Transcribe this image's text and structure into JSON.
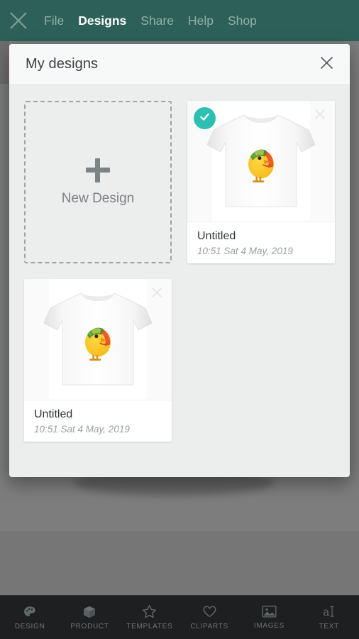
{
  "topbar": {
    "close_icon": "close-icon",
    "background": "#2d6157",
    "items": [
      {
        "label": "File",
        "active": false
      },
      {
        "label": "Designs",
        "active": true
      },
      {
        "label": "Share",
        "active": false
      },
      {
        "label": "Help",
        "active": false
      },
      {
        "label": "Shop",
        "active": false
      }
    ]
  },
  "modal": {
    "title": "My designs",
    "close_icon": "close-icon",
    "new_design": {
      "label": "New Design",
      "icon": "plus-icon"
    },
    "designs": [
      {
        "title": "Untitled",
        "date": "10:51 Sat 4 May, 2019",
        "selected": true,
        "check_icon": "check-icon",
        "remove_icon": "close-icon",
        "thumbnail": "tshirt-bird-thumbnail"
      },
      {
        "title": "Untitled",
        "date": "10:51 Sat 4 May, 2019",
        "selected": false,
        "check_icon": "check-icon",
        "remove_icon": "close-icon",
        "thumbnail": "tshirt-bird-thumbnail"
      }
    ]
  },
  "bottombar": {
    "background": "#1d1f21",
    "items": [
      {
        "label": "DESIGN",
        "icon": "palette-icon"
      },
      {
        "label": "PRODUCT",
        "icon": "box-icon"
      },
      {
        "label": "TEMPLATES",
        "icon": "star-icon"
      },
      {
        "label": "CLIPARTS",
        "icon": "heart-icon"
      },
      {
        "label": "IMAGES",
        "icon": "image-icon"
      },
      {
        "label": "TEXT",
        "icon": "text-cursor-icon"
      }
    ]
  },
  "colors": {
    "accent_teal": "#2cc0b3",
    "topbar_green": "#2d6157",
    "modal_bg": "#eceded",
    "toolbar_dark": "#1d1f21"
  }
}
